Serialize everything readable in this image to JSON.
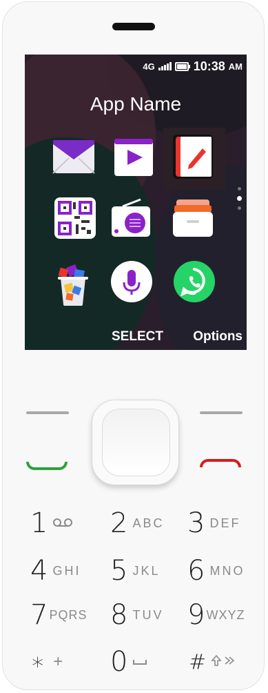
{
  "status": {
    "network": "4G",
    "time": "10:38",
    "ampm": "AM"
  },
  "screen": {
    "app_name": "App Name"
  },
  "apps": [
    {
      "name": "email-app-icon"
    },
    {
      "name": "video-app-icon"
    },
    {
      "name": "notes-app-icon"
    },
    {
      "name": "qr-scanner-app-icon"
    },
    {
      "name": "radio-app-icon"
    },
    {
      "name": "file-box-app-icon"
    },
    {
      "name": "store-bag-app-icon"
    },
    {
      "name": "voice-assistant-app-icon"
    },
    {
      "name": "whatsapp-app-icon"
    }
  ],
  "softkeys": {
    "center": "SELECT",
    "right": "Options"
  },
  "keypad": [
    {
      "digit": "1",
      "letters": ""
    },
    {
      "digit": "2",
      "letters": "ABC"
    },
    {
      "digit": "3",
      "letters": "DEF"
    },
    {
      "digit": "4",
      "letters": "GHI"
    },
    {
      "digit": "5",
      "letters": "JKL"
    },
    {
      "digit": "6",
      "letters": "MNO"
    },
    {
      "digit": "7",
      "letters": "PQRS"
    },
    {
      "digit": "8",
      "letters": "TUV"
    },
    {
      "digit": "9",
      "letters": "WXYZ"
    },
    {
      "digit": "∗",
      "letters": "+"
    },
    {
      "digit": "0",
      "letters": ""
    },
    {
      "digit": "#",
      "letters": ""
    }
  ],
  "colors": {
    "call_green": "#2aa33a",
    "end_red": "#d81b1b",
    "accent_purple": "#8a22c9",
    "whatsapp_green": "#25d366"
  }
}
